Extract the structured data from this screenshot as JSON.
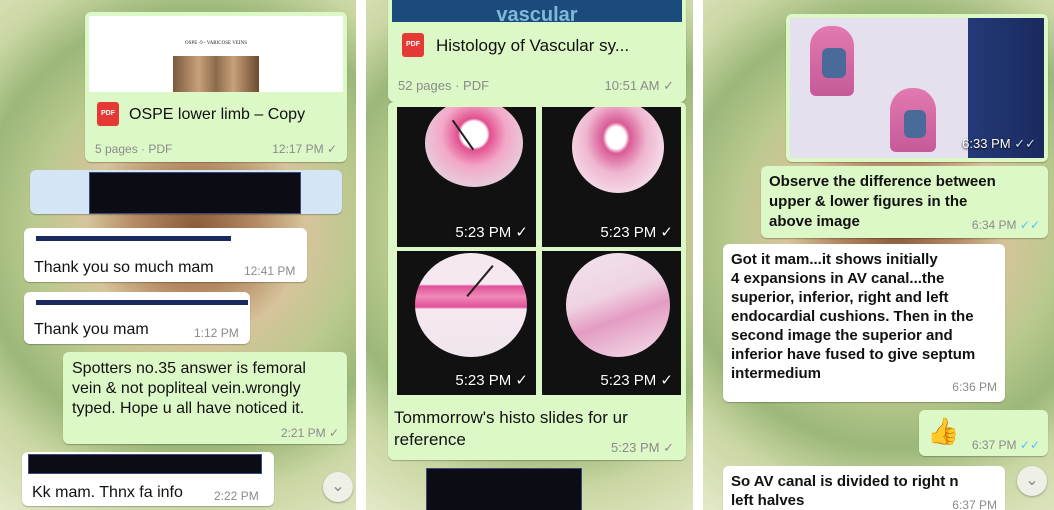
{
  "panel1": {
    "doc": {
      "thumb_title": "OSPE -9 - VARICOSE VEINS",
      "name": "OSPE lower limb – Copy",
      "info": "5 pages · PDF",
      "time": "12:17 PM",
      "tick": "✓"
    },
    "msg1": {
      "text": "Thank you so much mam",
      "time": "12:41 PM"
    },
    "msg2": {
      "text": "Thank you mam",
      "time": "1:12 PM"
    },
    "msg3": {
      "lines": [
        "Spotters no.35 answer is  femoral",
        "vein & not popliteal vein.wrongly",
        "typed. Hope u all have noticed it."
      ],
      "time": "2:21 PM",
      "tick": "✓"
    },
    "msg4": {
      "text": "Kk mam. Thnx fa info",
      "time": "2:22 PM"
    },
    "scroll_icon": "chevron-down-icon",
    "scroll_glyph": "⌄"
  },
  "panel2": {
    "doc": {
      "thumb_title": "vascular",
      "name": "Histology of Vascular sy...",
      "info": "52 pages · PDF",
      "time": "10:51 AM",
      "tick": "✓"
    },
    "images": [
      {
        "time": "5:23 PM",
        "tick": "✓"
      },
      {
        "time": "5:23 PM",
        "tick": "✓"
      },
      {
        "time": "5:23 PM",
        "tick": "✓"
      },
      {
        "time": "5:23 PM",
        "tick": "✓"
      }
    ],
    "caption": {
      "lines": [
        "Tommorrow's histo slides for ur",
        "reference"
      ],
      "time": "5:23 PM",
      "tick": "✓"
    }
  },
  "panel3": {
    "image": {
      "time": "6:33 PM",
      "tick": "✓✓"
    },
    "msg1": {
      "lines": [
        "Observe the difference between",
        "upper & lower figures in the",
        "above image"
      ],
      "time": "6:34 PM",
      "tick": "✓✓"
    },
    "msg2": {
      "lines": [
        "Got it mam...it shows initially",
        "4 expansions in AV canal...the",
        "superior, inferior, right and left",
        "endocardial cushions. Then in the",
        "second image the superior and",
        "inferior have fused to give septum",
        "intermedium"
      ],
      "time": "6:36 PM"
    },
    "msg3": {
      "emoji": "👍",
      "time": "6:37 PM",
      "tick": "✓✓"
    },
    "msg4": {
      "lines": [
        "So AV canal is divided to right n",
        "left halves"
      ],
      "time": "6:37 PM"
    },
    "scroll_icon": "chevron-down-icon",
    "scroll_glyph": "⌄"
  },
  "colors": {
    "incoming": "#ffffff",
    "outgoing": "#dcf8c6",
    "read_tick": "#4fc3f7",
    "pdf_red": "#e53935"
  }
}
